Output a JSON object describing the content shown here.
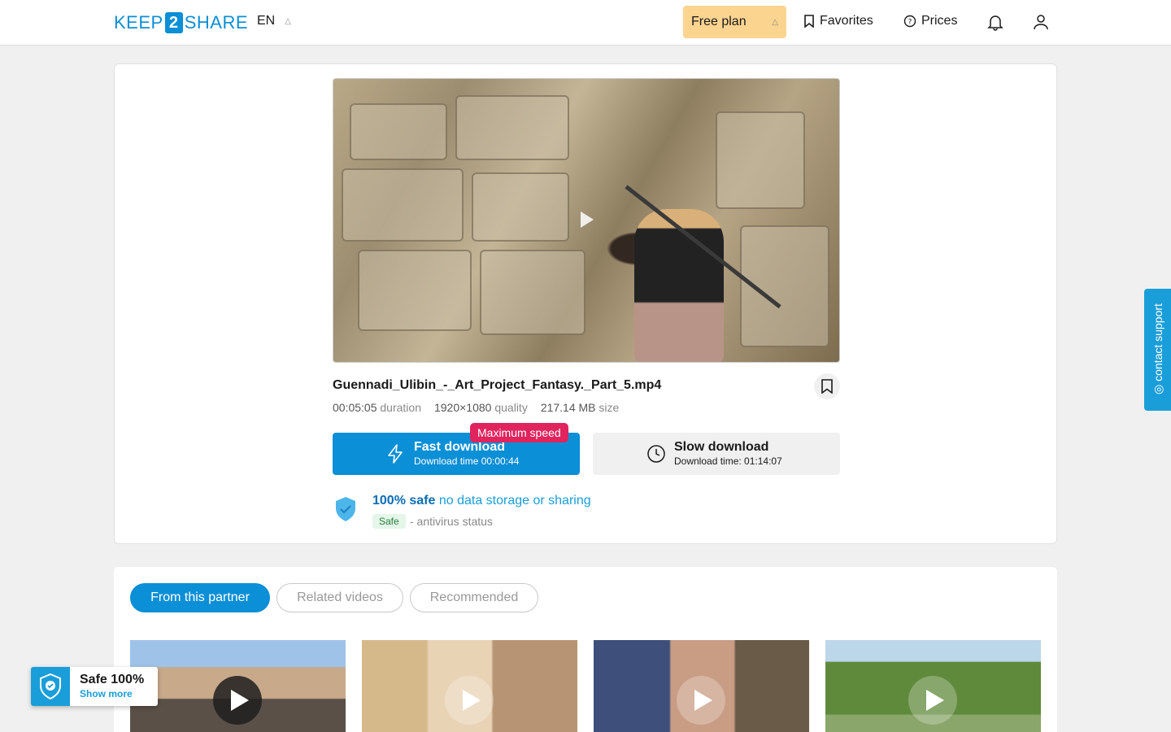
{
  "header": {
    "logo_left": "KEEP",
    "logo_num": "2",
    "logo_right": "SHARE",
    "language": "EN",
    "free_plan": "Free plan",
    "favorites": "Favorites",
    "prices": "Prices"
  },
  "file": {
    "name": "Guennadi_Ulibin_-_Art_Project_Fantasy._Part_5.mp4",
    "duration": "00:05:05",
    "duration_label": "duration",
    "quality": "1920×1080",
    "quality_label": "quality",
    "size": "217.14 MB",
    "size_label": "size"
  },
  "download": {
    "badge": "Maximum speed",
    "fast_title": "Fast download",
    "fast_sub": "Download time 00:00:44",
    "slow_title": "Slow download",
    "slow_sub": "Download time: 01:14:07"
  },
  "safety": {
    "bold": "100% safe",
    "rest": "no data storage or sharing",
    "badge": "Safe",
    "status": "- antivirus status"
  },
  "tabs": [
    {
      "label": "From this partner",
      "active": true
    },
    {
      "label": "Related videos",
      "active": false
    },
    {
      "label": "Recommended",
      "active": false
    }
  ],
  "support": {
    "label": "contact support"
  },
  "safe_float": {
    "title": "Safe 100%",
    "more": "Show more"
  },
  "colors": {
    "brand": "#0b8fd6",
    "plan": "#fbd490",
    "badge": "#e0245e"
  }
}
